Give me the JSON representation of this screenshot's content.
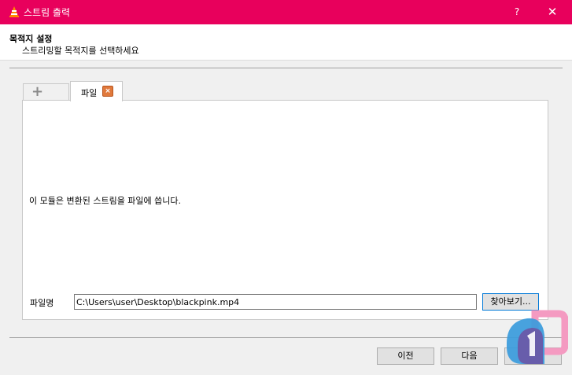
{
  "window": {
    "title": "스트림 출력",
    "help_label": "?",
    "close_label": "✕",
    "icon": "vlc-cone-icon",
    "title_bar_color": "#e8005c"
  },
  "header": {
    "title": "목적지 설정",
    "subtitle": "스트리밍할 목적지를 선택하세요"
  },
  "tabs": [
    {
      "label": "+",
      "icon": "plus-icon"
    },
    {
      "label": "파일",
      "close_icon": "close-x-icon",
      "active": true
    }
  ],
  "panel": {
    "description": "이 모듈은 변환된 스트림을 파일에 씁니다.",
    "filename_label": "파일명",
    "filename_value": "C:\\Users\\user\\Desktop\\blackpink.mp4",
    "browse_label": "찾아보기..."
  },
  "footer": {
    "prev_label": "이전",
    "next_label": "다음",
    "stream_label": ""
  }
}
